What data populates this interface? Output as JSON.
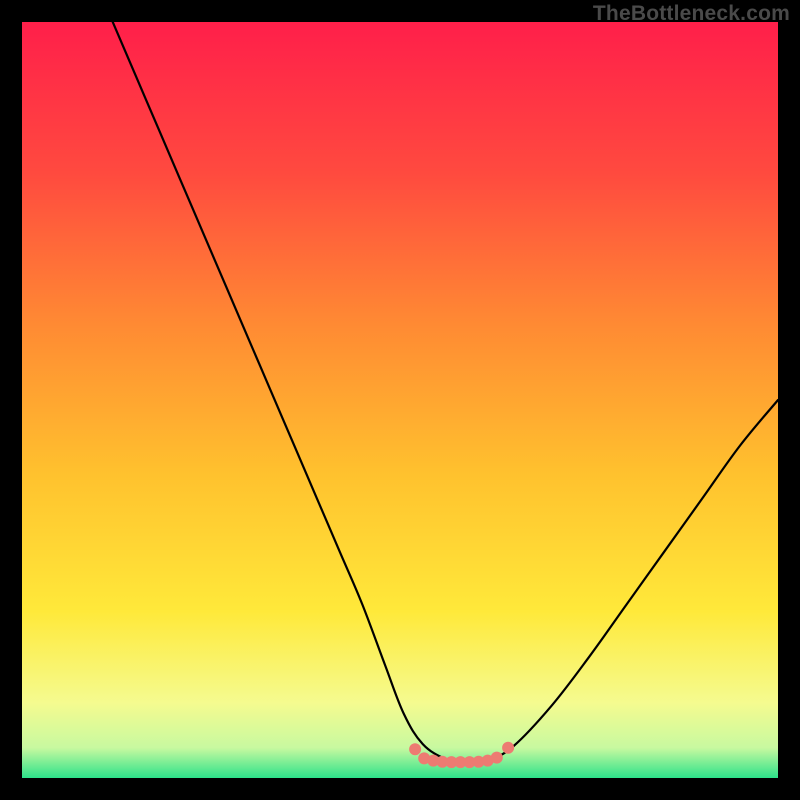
{
  "watermark": "TheBottleneck.com",
  "chart_data": {
    "type": "line",
    "title": "",
    "xlabel": "",
    "ylabel": "",
    "xlim": [
      0,
      100
    ],
    "ylim": [
      0,
      100
    ],
    "background_gradient_stops": [
      {
        "offset": 0.0,
        "color": "#ff1f4a"
      },
      {
        "offset": 0.2,
        "color": "#ff4a3f"
      },
      {
        "offset": 0.4,
        "color": "#ff8a33"
      },
      {
        "offset": 0.6,
        "color": "#ffc22e"
      },
      {
        "offset": 0.78,
        "color": "#ffe93a"
      },
      {
        "offset": 0.9,
        "color": "#f5fb8f"
      },
      {
        "offset": 0.96,
        "color": "#c8f9a0"
      },
      {
        "offset": 1.0,
        "color": "#2de28a"
      }
    ],
    "series": [
      {
        "name": "curve",
        "stroke": "#000000",
        "x": [
          12,
          15,
          18,
          21,
          24,
          27,
          30,
          33,
          36,
          39,
          42,
          45,
          48,
          50.5,
          53,
          56,
          58,
          60,
          62,
          65,
          70,
          75,
          80,
          85,
          90,
          95,
          100
        ],
        "y": [
          100,
          93,
          86,
          79,
          72,
          65,
          58,
          51,
          44,
          37,
          30,
          23,
          15,
          8.5,
          4.5,
          2.5,
          2.2,
          2.2,
          2.5,
          4.2,
          9.5,
          16,
          23,
          30,
          37,
          44,
          50
        ]
      }
    ],
    "markers": {
      "name": "flat-region-dots",
      "color": "#ed7b72",
      "radius": 6,
      "x": [
        52.0,
        53.2,
        54.4,
        55.6,
        56.8,
        58.0,
        59.2,
        60.4,
        61.6,
        62.8,
        64.3
      ],
      "y": [
        3.8,
        2.6,
        2.3,
        2.15,
        2.1,
        2.1,
        2.1,
        2.15,
        2.3,
        2.7,
        4.0
      ]
    }
  }
}
